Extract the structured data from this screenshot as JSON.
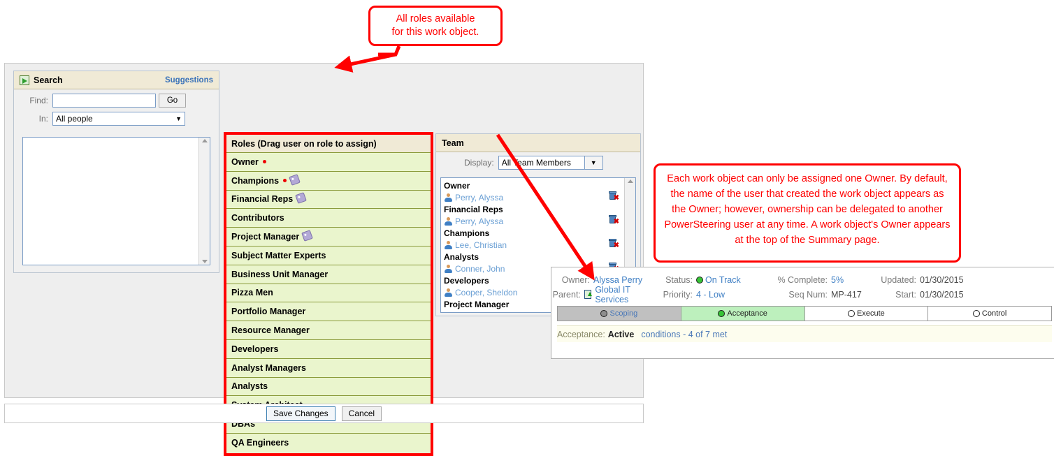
{
  "search_panel": {
    "title": "Search",
    "icon": "search-icon",
    "suggestions_label": "Suggestions",
    "find_label": "Find:",
    "find_value": "",
    "find_placeholder": "",
    "go_label": "Go",
    "in_label": "In:",
    "in_value": "All people",
    "in_caret": "▼"
  },
  "roles_panel": {
    "header": "Roles (Drag user on role to assign)",
    "border_color": "#ff0000",
    "row_bg": "#eaf5cd",
    "items": [
      {
        "label": "Owner",
        "required": true,
        "tag": false
      },
      {
        "label": "Champions",
        "required": true,
        "tag": true
      },
      {
        "label": "Financial Reps",
        "required": false,
        "tag": true
      },
      {
        "label": "Contributors",
        "required": false,
        "tag": false
      },
      {
        "label": "Project Manager",
        "required": false,
        "tag": true
      },
      {
        "label": "Subject Matter Experts",
        "required": false,
        "tag": false
      },
      {
        "label": "Business Unit Manager",
        "required": false,
        "tag": false
      },
      {
        "label": "Pizza Men",
        "required": false,
        "tag": false
      },
      {
        "label": "Portfolio Manager",
        "required": false,
        "tag": false
      },
      {
        "label": "Resource Manager",
        "required": false,
        "tag": false
      },
      {
        "label": "Developers",
        "required": false,
        "tag": false
      },
      {
        "label": "Analyst Managers",
        "required": false,
        "tag": false
      },
      {
        "label": "Analysts",
        "required": false,
        "tag": false
      },
      {
        "label": "System Architect",
        "required": false,
        "tag": false
      },
      {
        "label": "DBAs",
        "required": false,
        "tag": false
      },
      {
        "label": "QA Engineers",
        "required": false,
        "tag": false
      }
    ]
  },
  "team_panel": {
    "header": "Team",
    "display_label": "Display:",
    "display_value": "All Team Members",
    "display_caret": "▼",
    "groups": [
      {
        "role": "Owner",
        "members": [
          "Perry, Alyssa"
        ]
      },
      {
        "role": "Financial Reps",
        "members": [
          "Perry, Alyssa"
        ]
      },
      {
        "role": "Champions",
        "members": [
          "Lee, Christian"
        ]
      },
      {
        "role": "Analysts",
        "members": [
          "Conner, John"
        ]
      },
      {
        "role": "Developers",
        "members": [
          "Cooper, Sheldon"
        ]
      },
      {
        "role": "Project Manager",
        "members": []
      }
    ]
  },
  "buttons": {
    "save_label": "Save Changes",
    "cancel_label": "Cancel"
  },
  "detail_panel": {
    "fields": [
      {
        "label": "Owner:",
        "value": "Alyssa Perry",
        "link": true
      },
      {
        "label": "Status:",
        "value": "On Track",
        "link": true,
        "icon": "status-green-dot-icon"
      },
      {
        "label": "% Complete:",
        "value": "5%",
        "link": true
      },
      {
        "label": "Updated:",
        "value": "01/30/2015",
        "link": false
      },
      {
        "label": "Parent:",
        "value": "Global IT Services",
        "link": true,
        "icon": "parent-up-arrow-icon"
      },
      {
        "label": "Priority:",
        "value": "4 - Low",
        "link": true
      },
      {
        "label": "Seq Num:",
        "value": "MP-417",
        "link": false
      },
      {
        "label": "Start:",
        "value": "01/30/2015",
        "link": false
      }
    ],
    "stages": [
      {
        "label": "Scoping",
        "state": "cur",
        "icon": "stage-grey-dot-icon"
      },
      {
        "label": "Acceptance",
        "state": "act",
        "icon": "stage-green-dot-icon"
      },
      {
        "label": "Execute",
        "state": "fut",
        "icon": "stage-white-dot-icon"
      },
      {
        "label": "Control",
        "state": "fut",
        "icon": "stage-white-dot-icon"
      }
    ],
    "condition": {
      "prefix": "Acceptance:",
      "state": "Active",
      "link": "conditions - 4 of 7 met"
    }
  },
  "callouts": {
    "roles": "All roles available\nfor this work object.",
    "owner": "Each work object can only be assigned one Owner. By default, the name of the user that created the work object appears as the Owner; however, ownership can be delegated to another PowerSteering user at any time. A work object's Owner appears at the top of the Summary page."
  }
}
